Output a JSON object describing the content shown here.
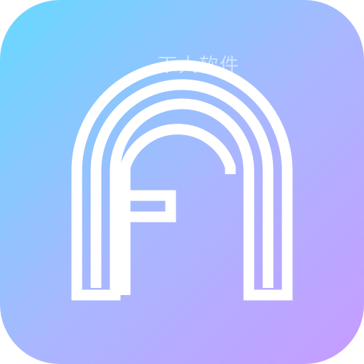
{
  "app_icon": {
    "name": "Fa app icon",
    "watermark_text": "下大软件",
    "colors": {
      "gradient_start": "#66d9ff",
      "gradient_mid": "#a9b7ff",
      "gradient_end": "#c79bff",
      "mark": "#ffffff"
    },
    "icon_names": [
      "fa-logo-mark"
    ]
  }
}
